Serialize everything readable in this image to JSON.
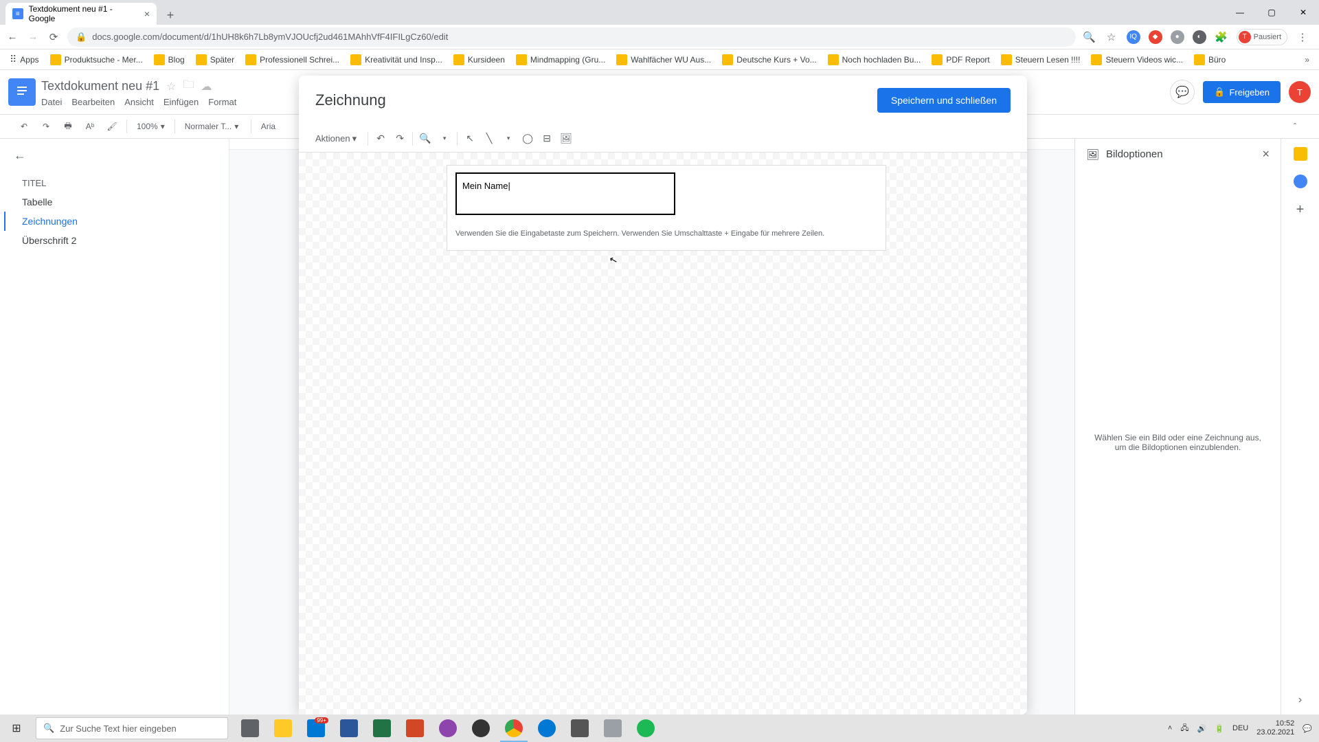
{
  "browser": {
    "tab_title": "Textdokument neu #1 - Google",
    "url": "docs.google.com/document/d/1hUH8k6h7Lb8ymVJOUcfj2ud461MAhhVfF4IFILgCz60/edit",
    "paused_label": "Pausiert",
    "bookmarks": [
      "Apps",
      "Produktsuche - Mer...",
      "Blog",
      "Später",
      "Professionell Schrei...",
      "Kreativität und Insp...",
      "Kursideen",
      "Mindmapping  (Gru...",
      "Wahlfächer WU Aus...",
      "Deutsche Kurs + Vo...",
      "Noch hochladen Bu...",
      "PDF Report",
      "Steuern Lesen !!!!",
      "Steuern Videos wic...",
      "Büro"
    ]
  },
  "docs": {
    "title": "Textdokument neu #1",
    "menus": [
      "Datei",
      "Bearbeiten",
      "Ansicht",
      "Einfügen",
      "Format"
    ],
    "share_label": "Freigeben",
    "zoom": "100%",
    "style_select": "Normaler T...",
    "font_select": "Aria"
  },
  "outline": {
    "items": [
      {
        "label": "TITEL",
        "level": 1
      },
      {
        "label": "Tabelle",
        "level": 2
      },
      {
        "label": "Zeichnungen",
        "level": 2,
        "active": true
      },
      {
        "label": "Überschrift 2",
        "level": 2
      }
    ]
  },
  "side_panel": {
    "title": "Bildoptionen",
    "empty_text": "Wählen Sie ein Bild oder eine Zeichnung aus, um die Bildoptionen einzublenden."
  },
  "modal": {
    "title": "Zeichnung",
    "save_label": "Speichern und schließen",
    "actions_label": "Aktionen",
    "text_value": "Mein Name",
    "hint": "Verwenden Sie die Eingabetaste zum Speichern. Verwenden Sie Umschalttaste + Eingabe für mehrere Zeilen."
  },
  "taskbar": {
    "search_placeholder": "Zur Suche Text hier eingeben",
    "lang": "DEU",
    "time": "10:52",
    "date": "23.02.2021",
    "badge": "99+"
  }
}
